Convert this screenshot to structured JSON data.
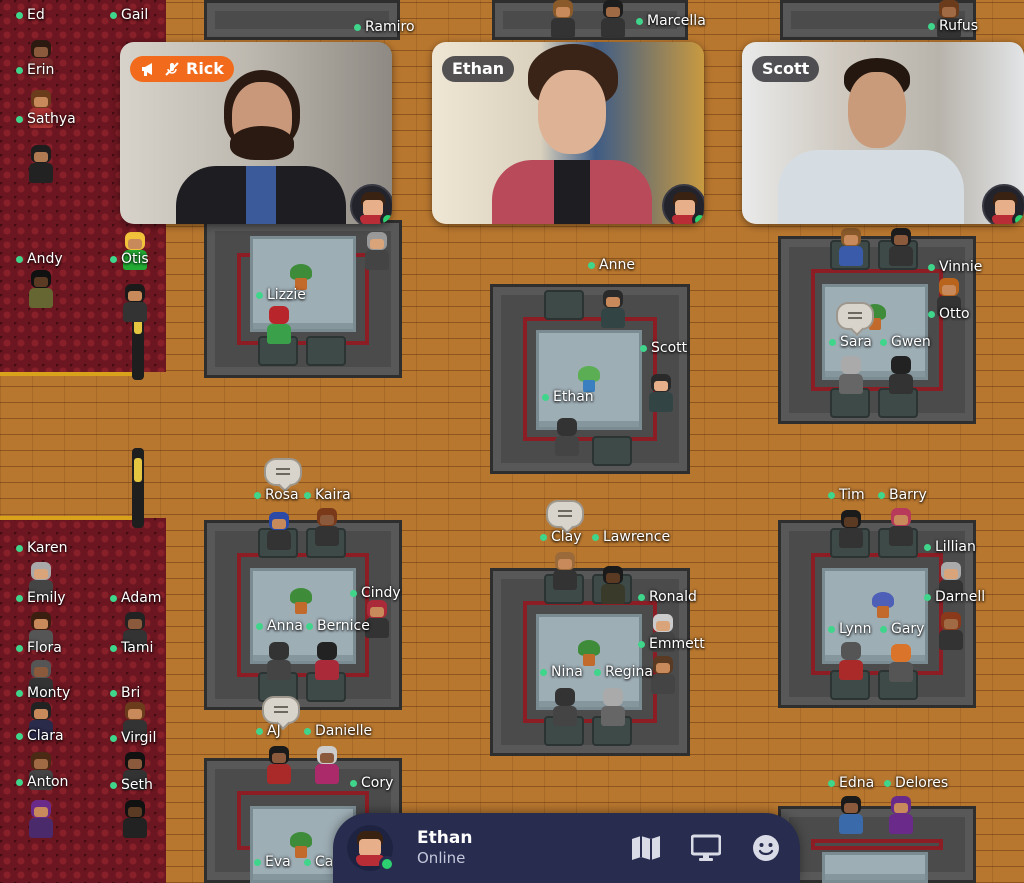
{
  "map": {
    "left_room_names": [
      "Ed",
      "Gail",
      "Erin",
      "Sathya",
      "Andy",
      "Otis",
      "Karen",
      "Emily",
      "Adam",
      "Flora",
      "Tami",
      "Monty",
      "Bri",
      "Clara",
      "Virgil",
      "Anton",
      "Seth"
    ],
    "center_names": [
      "Ramiro",
      "Marcella",
      "Rufus",
      "Lizzie",
      "Anne",
      "Scott",
      "Ethan",
      "Vinnie",
      "Otto",
      "Sara",
      "Gwen"
    ],
    "lower_names": [
      "Rosa",
      "Kaira",
      "Clay",
      "Lawrence",
      "Tim",
      "Barry",
      "Lillian",
      "Cindy",
      "Ronald",
      "Darnell",
      "Anna",
      "Bernice",
      "Emmett",
      "Lynn",
      "Gary",
      "Nina",
      "Regina",
      "AJ",
      "Danielle",
      "Cory",
      "Edna",
      "Delores",
      "Eva",
      "Ca"
    ]
  },
  "video_tiles": [
    {
      "name": "Rick",
      "role": "host",
      "host_icons": [
        "megaphone-icon",
        "mic-off-icon"
      ]
    },
    {
      "name": "Ethan"
    },
    {
      "name": "Scott"
    }
  ],
  "bottom_bar": {
    "name": "Ethan",
    "status": "Online",
    "actions": [
      "map-icon",
      "screen-share-icon",
      "emoji-icon"
    ]
  },
  "colors": {
    "floor": "#b8772f",
    "rug": "#6b1620",
    "online": "#3fd58a",
    "host_label": "#f26b1d",
    "bar": "#282d4f"
  }
}
